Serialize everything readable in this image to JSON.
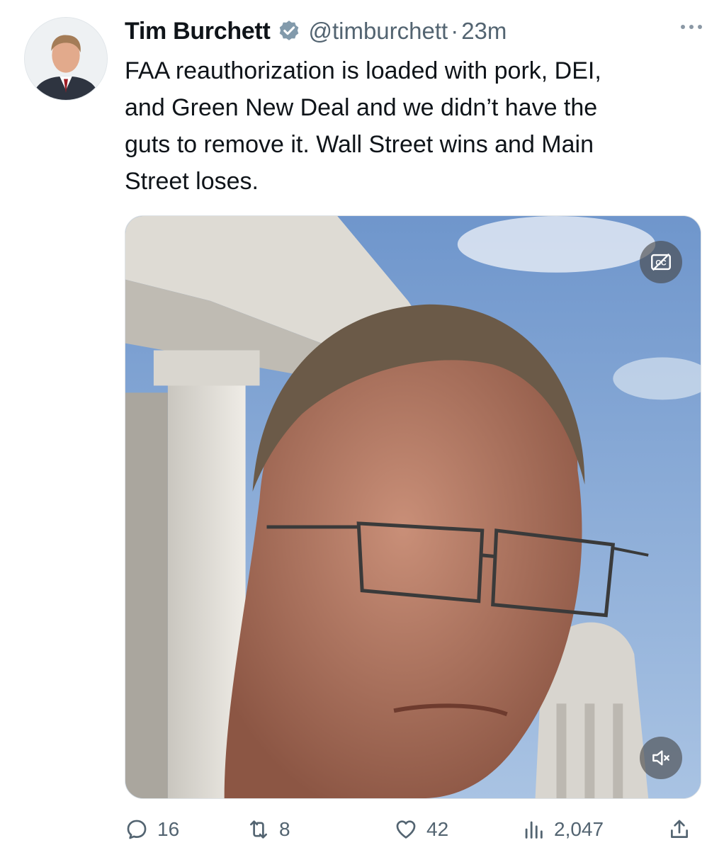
{
  "author": {
    "name": "Tim Burchett",
    "handle": "@timburchett",
    "separator": "·",
    "time": "23m"
  },
  "tweet": {
    "text": "FAA reauthorization is loaded with pork, DEI,\nand Green New Deal and we didn’t have the\nguts to remove it.  Wall Street wins and Main\nStreet loses."
  },
  "media": {
    "cc_icon": "captions-off-icon",
    "mute_icon": "volume-muted-icon"
  },
  "metrics": {
    "replies": "16",
    "reposts": "8",
    "likes": "42",
    "views": "2,047"
  },
  "colors": {
    "text": "#0f1419",
    "secondary": "#536471",
    "verified": "#829aab"
  }
}
